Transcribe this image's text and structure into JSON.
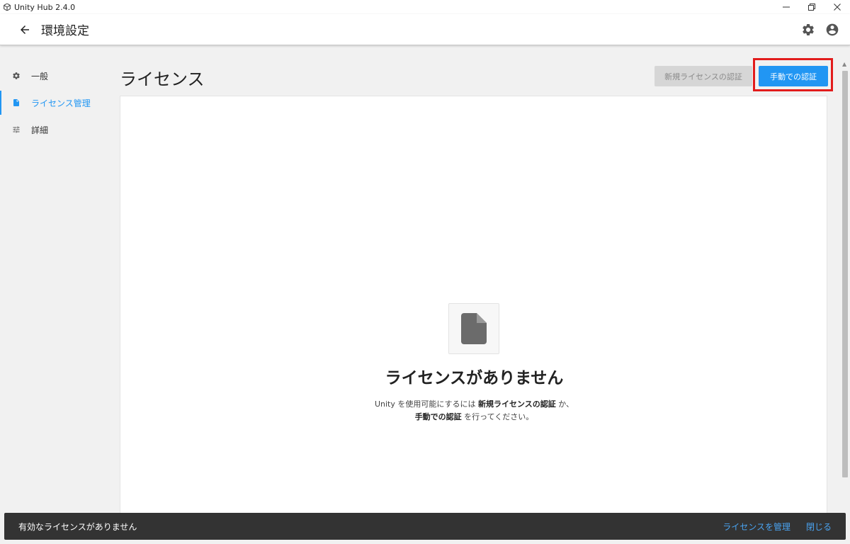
{
  "window": {
    "title": "Unity Hub 2.4.0",
    "controls": [
      "minimize",
      "restore",
      "close"
    ]
  },
  "header": {
    "title": "環境設定",
    "icons": [
      "arrow-left-icon",
      "gear-icon",
      "account-icon"
    ]
  },
  "sidebar": {
    "items": [
      {
        "label": "一般",
        "icon": "gear-icon",
        "active": false
      },
      {
        "label": "ライセンス管理",
        "icon": "document-icon",
        "active": true
      },
      {
        "label": "詳細",
        "icon": "sliders-icon",
        "active": false
      }
    ]
  },
  "main": {
    "title": "ライセンス",
    "new_license_button": "新規ライセンスの認証",
    "manual_activation_button": "手動での認証",
    "empty_state": {
      "icon": "document-icon",
      "title": "ライセンスがありません",
      "desc_line1_prefix": "Unity を使用可能にするには ",
      "desc_line1_bold": "新規ライセンスの認証",
      "desc_line1_suffix": " か、",
      "desc_line2_bold": "手動での認証",
      "desc_line2_suffix": " を行ってください。"
    }
  },
  "snackbar": {
    "message": "有効なライセンスがありません",
    "manage_link": "ライセンスを管理",
    "close_link": "閉じる"
  },
  "colors": {
    "accent": "#2196f3",
    "highlight": "#e21c1c",
    "snackbar_bg": "#333333"
  }
}
